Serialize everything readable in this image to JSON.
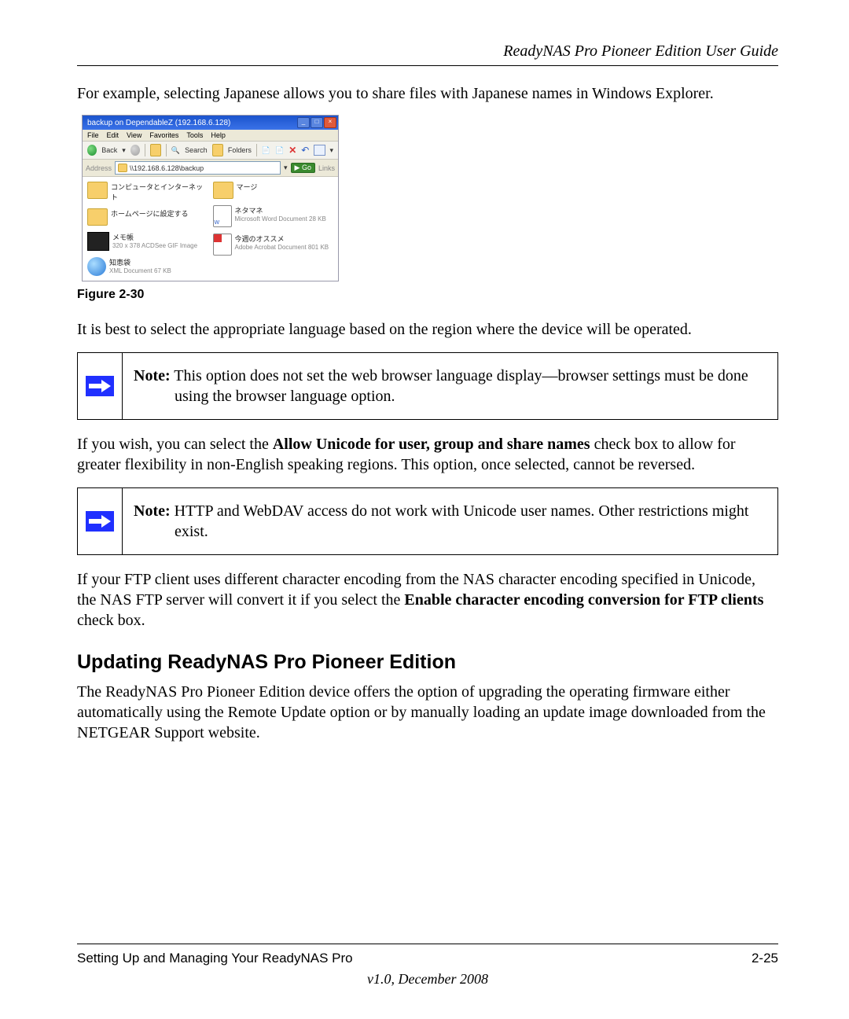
{
  "header": {
    "title": "ReadyNAS Pro Pioneer Edition User Guide"
  },
  "p1": "For example, selecting Japanese allows you to share files with Japanese names in Windows Explorer.",
  "screenshot": {
    "titlebar": "backup on DependableZ (192.168.6.128)",
    "menu": {
      "file": "File",
      "edit": "Edit",
      "view": "View",
      "favorites": "Favorites",
      "tools": "Tools",
      "help": "Help"
    },
    "toolbar": {
      "back": "Back",
      "search": "Search",
      "folders": "Folders"
    },
    "address": {
      "label": "Address",
      "value": "\\\\192.168.6.128\\backup",
      "go": "Go",
      "links": "Links"
    },
    "items": {
      "leftA": "コンピュータとインターネット",
      "leftB": "ホームページに設定する",
      "gif_name": "メモ帳",
      "gif_meta": "320 x 378\nACDSee GIF Image",
      "ie_name": "知恵袋",
      "ie_meta": "XML Document\n67 KB",
      "rightA": "マージ",
      "doc_name": "ネタマネ",
      "doc_meta": "Microsoft Word Document\n28 KB",
      "pdf_name": "今週のオススメ",
      "pdf_meta": "Adobe Acrobat Document\n801 KB"
    }
  },
  "figcaption": "Figure 2-30",
  "p2": "It is best to select the appropriate language based on the region where the device will be operated.",
  "note1": {
    "label": "Note:",
    "text": " This option does not set the web browser language display—browser settings must be done using the browser language option."
  },
  "p3a": "If you wish, you can select the ",
  "p3bold": "Allow Unicode for user, group and share names",
  "p3b": " check box to allow for greater flexibility in non-English speaking regions. This option, once selected, cannot be reversed.",
  "note2": {
    "label": "Note:",
    "text": " HTTP and WebDAV access do not work with Unicode user names. Other restrictions might exist."
  },
  "p4a": "If your FTP client uses different character encoding from the NAS character encoding specified in Unicode, the NAS FTP server will convert it if you select the ",
  "p4bold": "Enable character encoding conversion for FTP clients",
  "p4b": " check box.",
  "h2": "Updating ReadyNAS Pro Pioneer Edition",
  "p5": "The ReadyNAS Pro Pioneer Edition device offers the option of upgrading the operating firmware either automatically using the Remote Update option or by manually loading an update image downloaded from the NETGEAR Support website.",
  "footer": {
    "left": "Setting Up and Managing Your ReadyNAS Pro",
    "right": "2-25",
    "version": "v1.0, December 2008"
  }
}
